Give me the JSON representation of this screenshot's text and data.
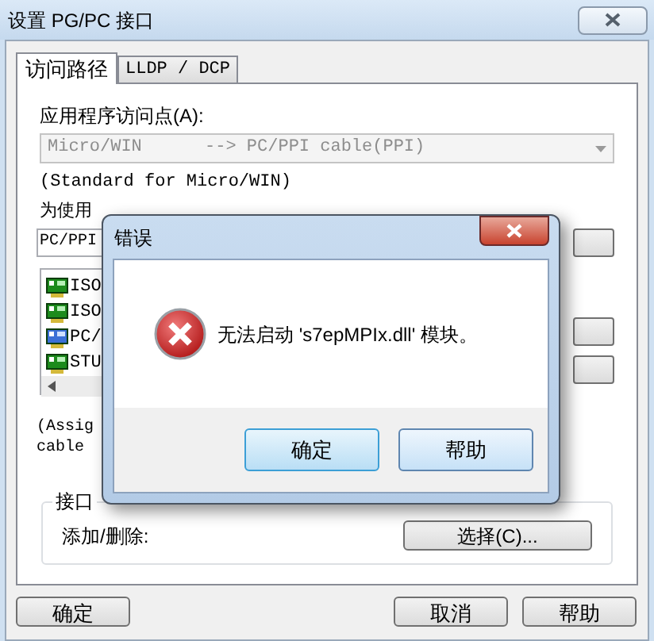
{
  "window": {
    "title": "设置 PG/PC 接口"
  },
  "tabs": [
    {
      "label": "访问路径",
      "selected": true
    },
    {
      "label": "LLDP / DCP",
      "selected": false
    }
  ],
  "access_point": {
    "label": "应用程序访问点(A):",
    "value": "Micro/WIN      --> PC/PPI cable(PPI)",
    "disabled": true,
    "note": "(Standard for Micro/WIN)"
  },
  "parameters": {
    "label": "为使用",
    "value": "PC/PPI",
    "items": [
      {
        "label": "ISO",
        "selected": false
      },
      {
        "label": "ISO",
        "selected": false
      },
      {
        "label": "PC/",
        "selected": true
      },
      {
        "label": "STU",
        "selected": false
      }
    ],
    "note_lines": [
      "(Assig",
      "cable"
    ]
  },
  "interface_group": {
    "title": "接口",
    "label": "添加/删除:",
    "button": "选择(C)..."
  },
  "buttons": [
    "确定",
    "取消",
    "帮助"
  ],
  "error_dialog": {
    "title": "错误",
    "message": "无法启动 's7epMPIx.dll' 模块。",
    "buttons": [
      "确定",
      "帮助"
    ]
  }
}
